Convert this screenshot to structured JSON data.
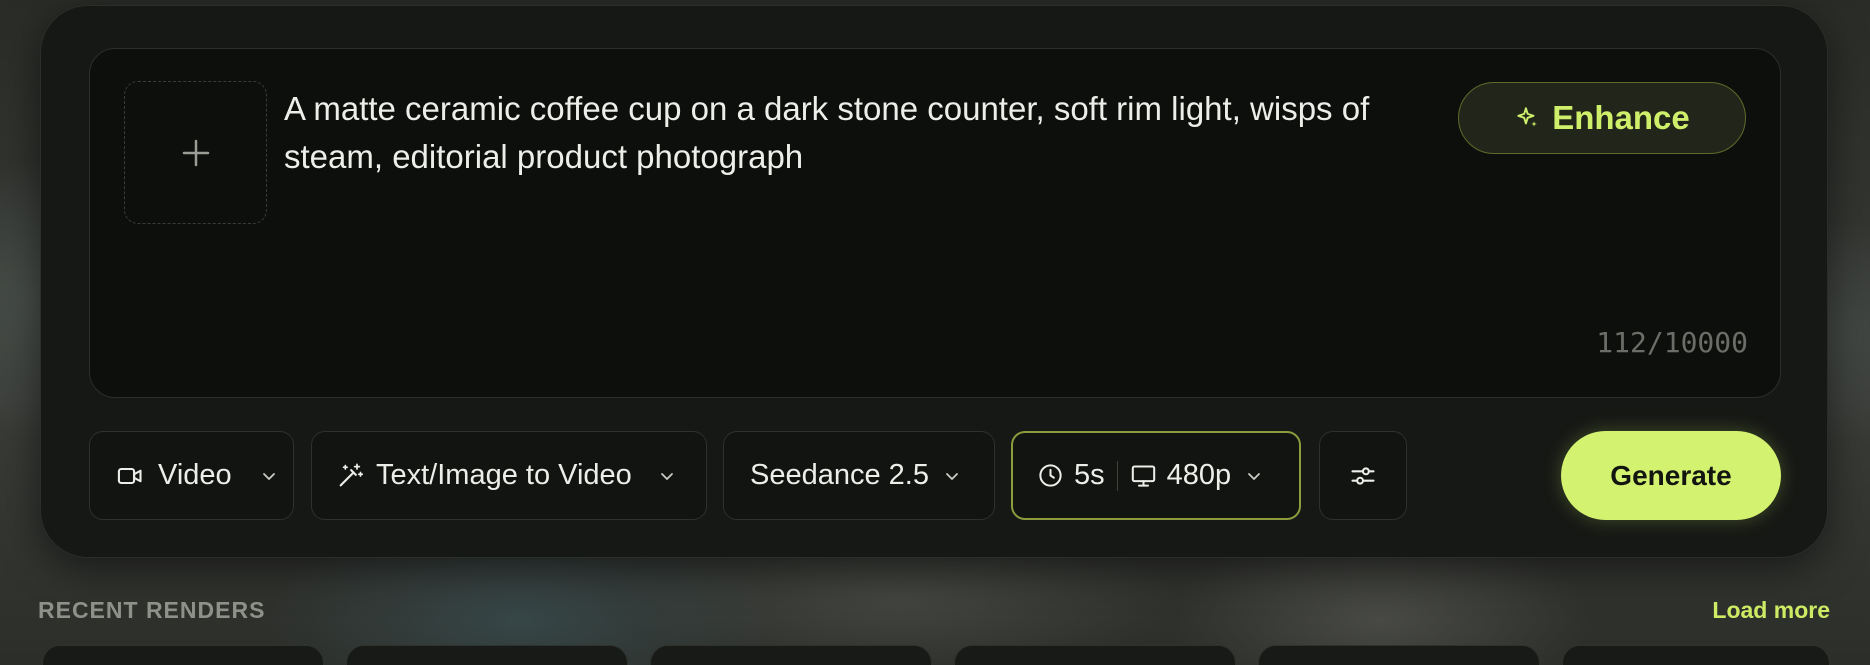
{
  "prompt": {
    "upload_icon": "plus-icon",
    "text": "A matte ceramic coffee cup on a dark stone counter, soft rim light, wisps of steam, editorial product photograph",
    "enhance_label": "Enhance",
    "enhance_icon": "sparkle-icon",
    "counter": "112/10000"
  },
  "toolbar": {
    "media_type": {
      "label": "Video",
      "icon": "video-camera-icon"
    },
    "mode": {
      "label": "Text/Image to Video",
      "icon": "magic-wand-icon"
    },
    "model": {
      "label": "Seedance 2.5"
    },
    "duration": {
      "label": "5s",
      "icon": "clock-icon"
    },
    "resolution": {
      "label": "480p",
      "icon": "monitor-icon"
    },
    "settings_icon": "sliders-icon",
    "generate_label": "Generate"
  },
  "recent": {
    "title": "RECENT RENDERS",
    "load_more": "Load more"
  },
  "colors": {
    "accent": "#d3f26f",
    "enhance_text": "#cfee6a",
    "panel": "#161815"
  }
}
